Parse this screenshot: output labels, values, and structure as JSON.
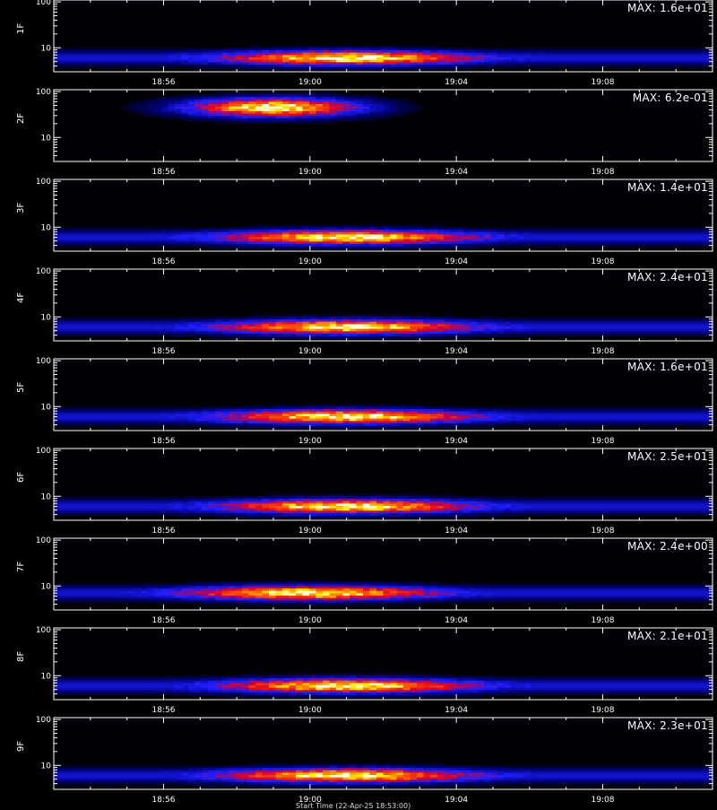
{
  "chart_data": [
    {
      "type": "heatmap",
      "ylabel": "1F",
      "max_label": "MAX: 1.6e+01",
      "yticks": [
        "100",
        "10"
      ],
      "xticks": [
        "18:56",
        "19:00",
        "19:04",
        "19:08"
      ],
      "ylim": [
        3,
        110
      ],
      "log_y": true,
      "band": {
        "freq_center": 6,
        "freq_spread": 1.2,
        "time_peak": "19:01",
        "intensity_peak": 16
      }
    },
    {
      "type": "heatmap",
      "ylabel": "2F",
      "max_label": "MAX: 6.2e-01",
      "yticks": [
        "100",
        "10"
      ],
      "xticks": [
        "18:56",
        "19:00",
        "19:04",
        "19:08"
      ],
      "ylim": [
        3,
        110
      ],
      "log_y": true,
      "band": {
        "freq_center": 45,
        "freq_spread": 12,
        "time_peak": "18:59",
        "intensity_peak": 0.62
      }
    },
    {
      "type": "heatmap",
      "ylabel": "3F",
      "max_label": "MAX: 1.4e+01",
      "yticks": [
        "100",
        "10"
      ],
      "xticks": [
        "18:56",
        "19:00",
        "19:04",
        "19:08"
      ],
      "ylim": [
        3,
        110
      ],
      "log_y": true,
      "band": {
        "freq_center": 6,
        "freq_spread": 1.2,
        "time_peak": "19:01",
        "intensity_peak": 14
      }
    },
    {
      "type": "heatmap",
      "ylabel": "4F",
      "max_label": "MAX: 2.4e+01",
      "yticks": [
        "100",
        "10"
      ],
      "xticks": [
        "18:56",
        "19:00",
        "19:04",
        "19:08"
      ],
      "ylim": [
        3,
        110
      ],
      "log_y": true,
      "band": {
        "freq_center": 6,
        "freq_spread": 1.2,
        "time_peak": "19:01",
        "intensity_peak": 24
      }
    },
    {
      "type": "heatmap",
      "ylabel": "5F",
      "max_label": "MAX: 1.6e+01",
      "yticks": [
        "100",
        "10"
      ],
      "xticks": [
        "18:56",
        "19:00",
        "19:04",
        "19:08"
      ],
      "ylim": [
        3,
        110
      ],
      "log_y": true,
      "band": {
        "freq_center": 6,
        "freq_spread": 1.2,
        "time_peak": "19:01",
        "intensity_peak": 16
      }
    },
    {
      "type": "heatmap",
      "ylabel": "6F",
      "max_label": "MAX: 2.5e+01",
      "yticks": [
        "100",
        "10"
      ],
      "xticks": [
        "18:56",
        "19:00",
        "19:04",
        "19:08"
      ],
      "ylim": [
        3,
        110
      ],
      "log_y": true,
      "band": {
        "freq_center": 6,
        "freq_spread": 1.2,
        "time_peak": "19:01",
        "intensity_peak": 25
      }
    },
    {
      "type": "heatmap",
      "ylabel": "7F",
      "max_label": "MAX: 2.4e+00",
      "yticks": [
        "100",
        "10"
      ],
      "xticks": [
        "18:56",
        "19:00",
        "19:04",
        "19:08"
      ],
      "ylim": [
        3,
        110
      ],
      "log_y": true,
      "band": {
        "freq_center": 7,
        "freq_spread": 1.4,
        "time_peak": "19:00",
        "intensity_peak": 2.4
      }
    },
    {
      "type": "heatmap",
      "ylabel": "8F",
      "max_label": "MAX: 2.1e+01",
      "yticks": [
        "100",
        "10"
      ],
      "xticks": [
        "18:56",
        "19:00",
        "19:04",
        "19:08"
      ],
      "ylim": [
        3,
        110
      ],
      "log_y": true,
      "band": {
        "freq_center": 6,
        "freq_spread": 1.2,
        "time_peak": "19:01",
        "intensity_peak": 21
      }
    },
    {
      "type": "heatmap",
      "ylabel": "9F",
      "max_label": "MAX: 2.3e+01",
      "yticks": [
        "100",
        "10"
      ],
      "xticks": [
        "18:56",
        "19:00",
        "19:04",
        "19:08"
      ],
      "ylim": [
        3,
        110
      ],
      "log_y": true,
      "band": {
        "freq_center": 6,
        "freq_spread": 1.2,
        "time_peak": "19:01",
        "intensity_peak": 23
      }
    }
  ],
  "footer": {
    "caption": "Start Time (22-Apr-25 18:53:00)"
  },
  "time_axis": {
    "start": "18:53",
    "end": "19:11"
  },
  "colors": {
    "background": "#000000",
    "axis": "#ffffff"
  }
}
